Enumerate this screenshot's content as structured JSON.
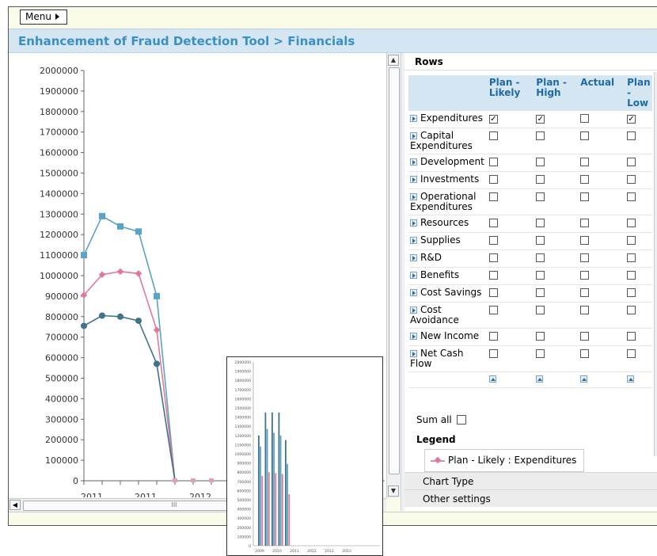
{
  "menu": {
    "label": "Menu"
  },
  "title": "Enhancement of Fraud Detection Tool > Financials",
  "main_chart": {
    "y_ticks": [
      "2000000",
      "1900000",
      "1800000",
      "1700000",
      "1600000",
      "1500000",
      "1400000",
      "1300000",
      "1200000",
      "1100000",
      "1000000",
      "900000",
      "800000",
      "700000",
      "600000",
      "500000",
      "400000",
      "300000",
      "200000",
      "100000",
      "0"
    ],
    "x_labels": [
      "2011",
      "2011",
      "2012"
    ]
  },
  "chart_data": [
    {
      "type": "line",
      "ylim": [
        0,
        2000000
      ],
      "x": [
        0,
        1,
        2,
        3,
        4,
        5,
        6,
        7
      ],
      "x_tick_labels": [
        "2011",
        "2011",
        "2012"
      ],
      "series": [
        {
          "color": "#5ba3c6",
          "marker": "square",
          "values": [
            1100000,
            1290000,
            1240000,
            1215000,
            900000,
            0,
            0,
            0
          ]
        },
        {
          "color": "#e07898",
          "marker": "diamond",
          "values": [
            905000,
            1005000,
            1020000,
            1010000,
            735000,
            0,
            0,
            0
          ]
        },
        {
          "color": "#3e7388",
          "marker": "circle",
          "values": [
            755000,
            805000,
            800000,
            780000,
            570000,
            0,
            0,
            0
          ]
        }
      ]
    },
    {
      "type": "bar",
      "ylim": [
        0,
        2000000
      ],
      "x_tick_labels": [
        "2009",
        "2010",
        "2011",
        "2012",
        "2012",
        "2013"
      ],
      "y_ticks": [
        "2000000",
        "1900000",
        "1800000",
        "1700000",
        "1600000",
        "1500000",
        "1400000",
        "1300000",
        "1200000",
        "1100000",
        "1000000",
        "900000",
        "800000",
        "700000",
        "600000",
        "500000",
        "400000",
        "300000",
        "200000",
        "100000",
        "0"
      ],
      "groups": [
        {
          "values": [
            1200000,
            1080000,
            760000
          ]
        },
        {
          "values": [
            1450000,
            1270000,
            800000
          ]
        },
        {
          "values": [
            1450000,
            1230000,
            790000
          ]
        },
        {
          "values": [
            1450000,
            1200000,
            780000
          ]
        },
        {
          "values": [
            1150000,
            890000,
            560000
          ]
        }
      ],
      "colors": [
        "#3e7388",
        "#5ba3c6",
        "#e07898"
      ]
    }
  ],
  "rows_panel": {
    "title": "Rows",
    "columns": [
      "Plan - Likely",
      "Plan - High",
      "Actual",
      "Plan - Low"
    ],
    "rows": [
      {
        "label": "Expenditures",
        "checks": [
          true,
          true,
          false,
          true
        ]
      },
      {
        "label": "Capital Expenditures",
        "checks": [
          false,
          false,
          false,
          false
        ]
      },
      {
        "label": "Development",
        "checks": [
          false,
          false,
          false,
          false
        ]
      },
      {
        "label": "Investments",
        "checks": [
          false,
          false,
          false,
          false
        ]
      },
      {
        "label": "Operational Expenditures",
        "checks": [
          false,
          false,
          false,
          false
        ]
      },
      {
        "label": "Resources",
        "checks": [
          false,
          false,
          false,
          false
        ]
      },
      {
        "label": "Supplies",
        "checks": [
          false,
          false,
          false,
          false
        ]
      },
      {
        "label": "R&D",
        "checks": [
          false,
          false,
          false,
          false
        ]
      },
      {
        "label": "Benefits",
        "checks": [
          false,
          false,
          false,
          false
        ]
      },
      {
        "label": "Cost Savings",
        "checks": [
          false,
          false,
          false,
          false
        ]
      },
      {
        "label": "Cost Avoidance",
        "checks": [
          false,
          false,
          false,
          false
        ]
      },
      {
        "label": "New Income",
        "checks": [
          false,
          false,
          false,
          false
        ]
      },
      {
        "label": "Net Cash Flow",
        "checks": [
          false,
          false,
          false,
          false
        ]
      }
    ],
    "sum_all_label": "Sum all",
    "legend_title": "Legend",
    "legend_item": "Plan - Likely : Expenditures",
    "legend_color": "#e07898"
  },
  "accordion": {
    "chart_type": "Chart Type",
    "other_settings": "Other settings"
  },
  "scroll": {
    "thumb_grip": "III"
  }
}
